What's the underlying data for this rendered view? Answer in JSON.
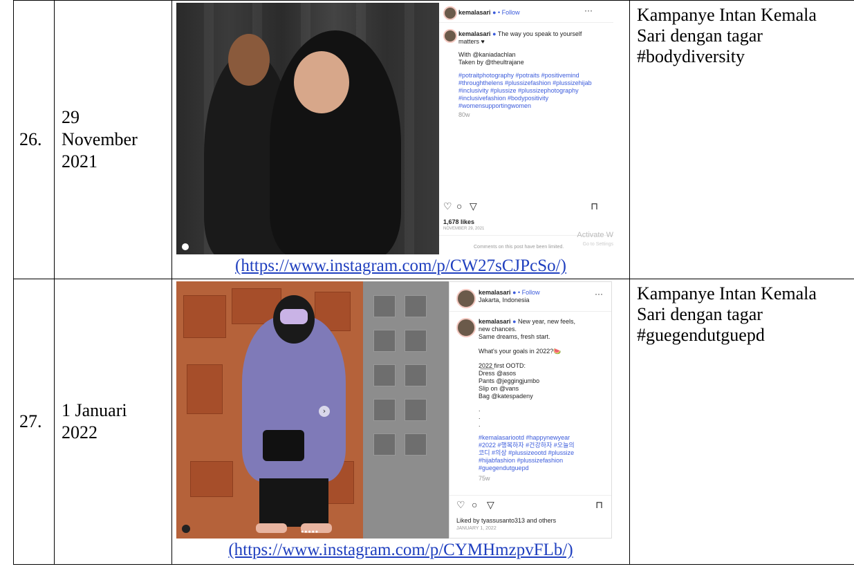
{
  "rows": [
    {
      "number": "26.",
      "date": "29 November 2021",
      "link": "(https://www.instagram.com/p/CW27sCJPcSo/)",
      "description": "Kampanye Intan Kemala Sari dengan tagar #bodydiversity",
      "post": {
        "username": "kemalasari",
        "follow": "• Follow",
        "more": "···",
        "caption_user": "kemalasari",
        "caption": "The way you speak to yourself matters ♥",
        "with": "With @kaniadachlan",
        "taken_by": "Taken by @theultrajane",
        "hashtags": "#potraitphotography #potraits #positivemind #throughthelens #plussizefashion #plussizehijab #inclusivity #plussize #plussizephotography #inclusivefashion #bodypositivity #womensupportingwomen",
        "age": "80w",
        "likes": "1,678 likes",
        "post_date": "NOVEMBER 29, 2021",
        "comments_note": "Comments on this post have been limited.",
        "watermark1": "Activate W",
        "watermark2": "Go to Settings"
      }
    },
    {
      "number": "27.",
      "date": "1 Januari 2022",
      "link": "(https://www.instagram.com/p/CYMHmzpvFLb/)",
      "description": "Kampanye Intan Kemala Sari dengan tagar #guegendutguepd",
      "post": {
        "username": "kemalasari",
        "follow": "• Follow",
        "location": "Jakarta, Indonesia",
        "more": "···",
        "caption_user": "kemalasari",
        "caption_lines": [
          "New year, new feels,",
          "new chances.",
          "Same dreams, fresh start.",
          "",
          "What's your goals in 2022?🍉",
          "",
          "2̲0̲2̲2̲ first OOTD:",
          "Dress @asos",
          "Pants @jeggingjumbo",
          "Slip on @vans",
          "Bag @katespadeny",
          ".",
          ".",
          ".",
          "#kemalasariootd #happynewyear",
          "#2022 #행복하자 #건강하자 #오늘의",
          "코디 #의상 #plussizeootd #plussize",
          "#hijabfashion #plussizefashion",
          "#guegendutguepd"
        ],
        "age": "75w",
        "liked_by": "Liked by tyassusanto313 and others",
        "post_date": "JANUARY 1, 2022"
      }
    }
  ],
  "icons": [
    "heart-icon",
    "comment-icon",
    "share-icon",
    "bookmark-icon",
    "verified-icon",
    "user-tag-icon",
    "next-arrow-icon"
  ]
}
